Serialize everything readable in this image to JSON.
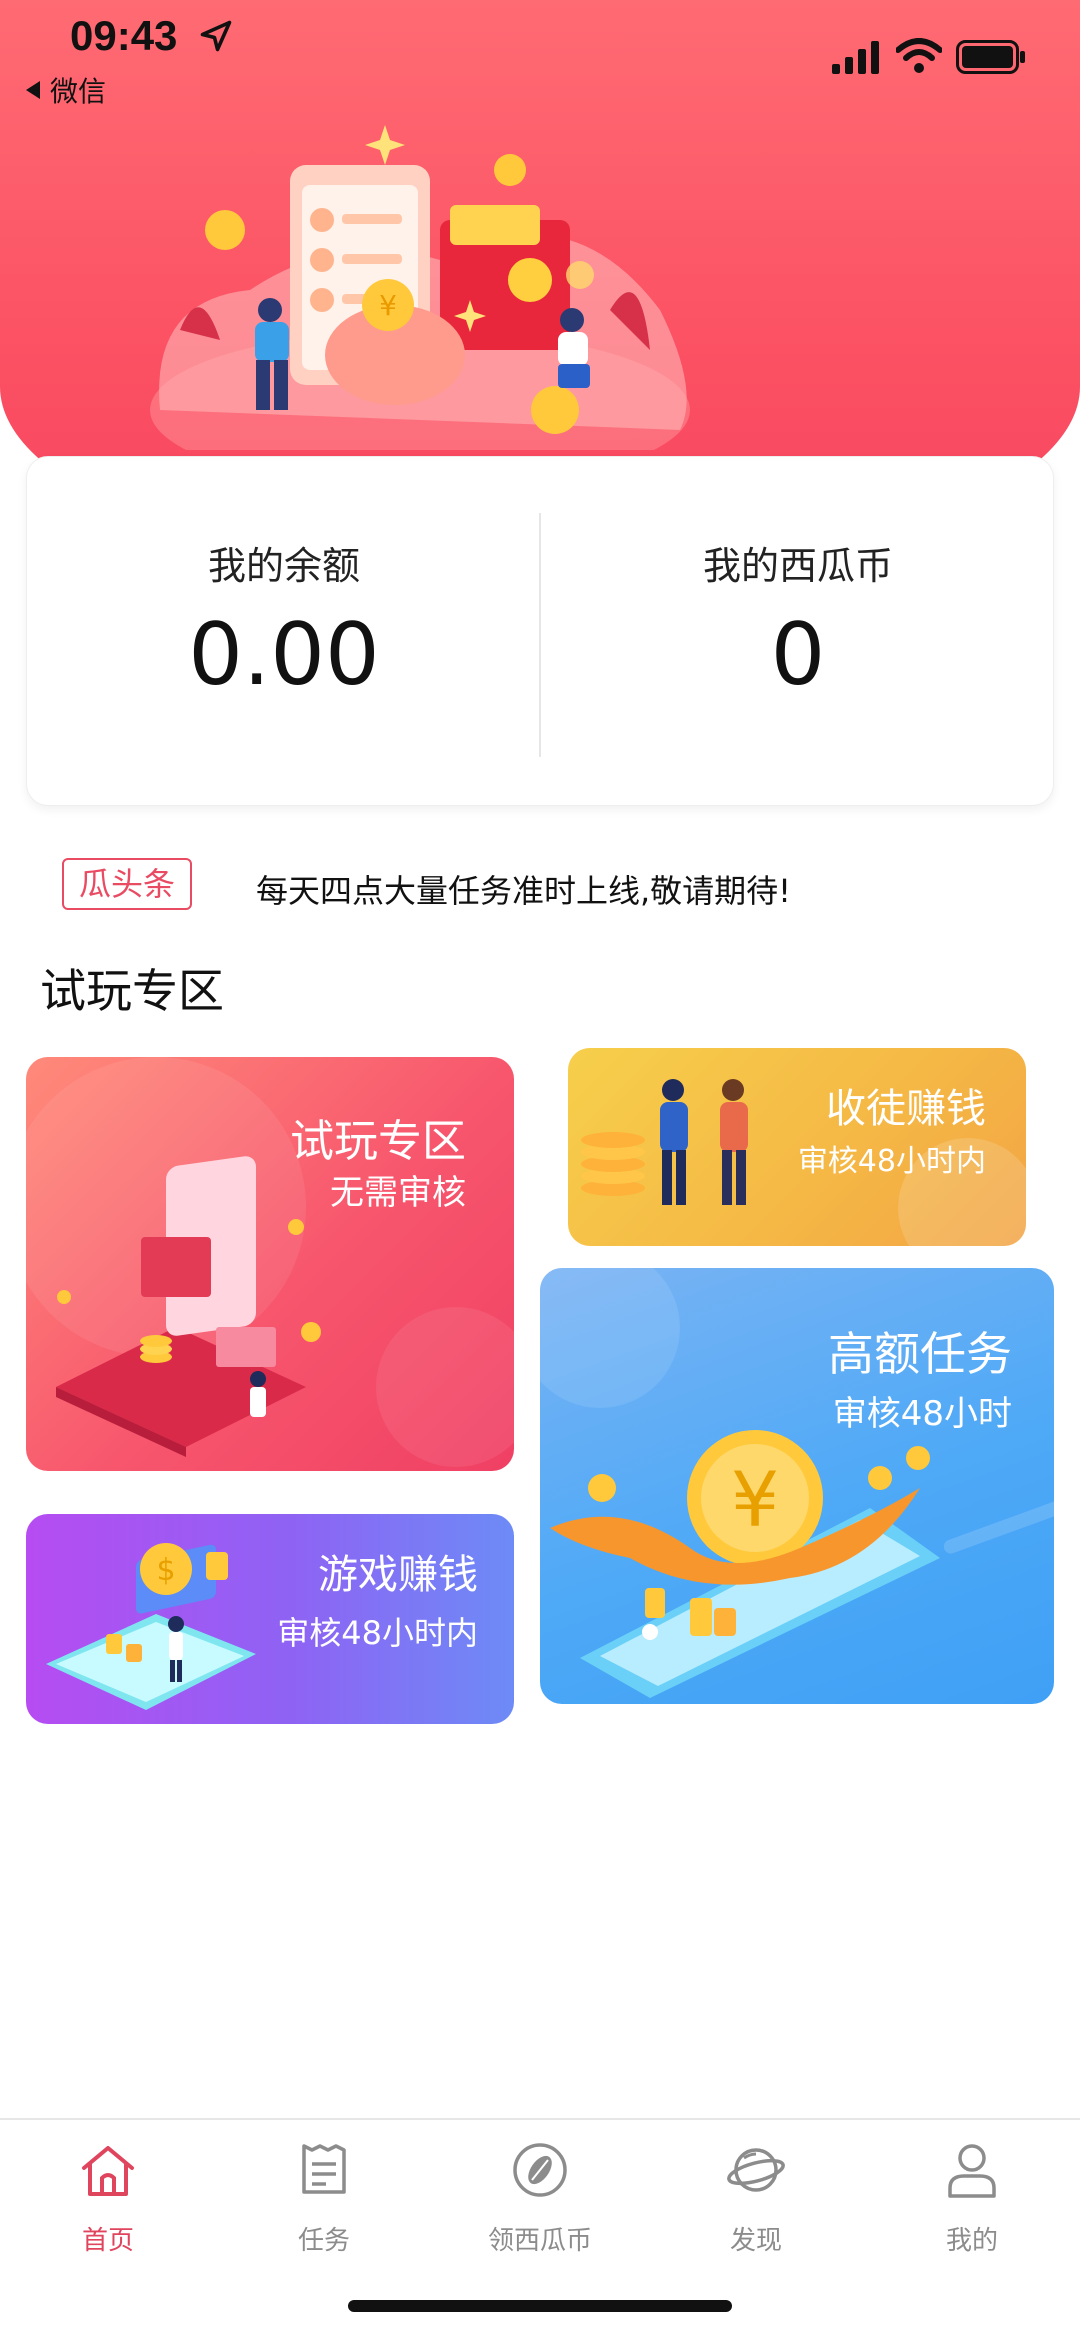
{
  "status_bar": {
    "time": "09:43",
    "back_app": "微信"
  },
  "balance": {
    "balance_label": "我的余额",
    "balance_value": "0.00",
    "coins_label": "我的西瓜币",
    "coins_value": "0"
  },
  "notice": {
    "tag": "瓜头条",
    "text": "每天四点大量任务准时上线,敬请期待!"
  },
  "section": {
    "title": "试玩专区"
  },
  "tiles": {
    "trial": {
      "title": "试玩专区",
      "subtitle": "无需审核"
    },
    "recruit": {
      "title": "收徒赚钱",
      "subtitle": "审核48小时内"
    },
    "high": {
      "title": "高额任务",
      "subtitle": "审核48小时"
    },
    "game": {
      "title": "游戏赚钱",
      "subtitle": "审核48小时内"
    }
  },
  "tabbar": {
    "items": [
      {
        "label": "首页",
        "icon": "home-icon",
        "active": true
      },
      {
        "label": "任务",
        "icon": "task-icon",
        "active": false
      },
      {
        "label": "领西瓜币",
        "icon": "melon-seed-icon",
        "active": false
      },
      {
        "label": "发现",
        "icon": "planet-icon",
        "active": false
      },
      {
        "label": "我的",
        "icon": "user-icon",
        "active": false
      }
    ]
  },
  "colors": {
    "brand_red": "#f54461",
    "active_tab": "#e0455e",
    "inactive_tab": "#8c8c8c"
  }
}
